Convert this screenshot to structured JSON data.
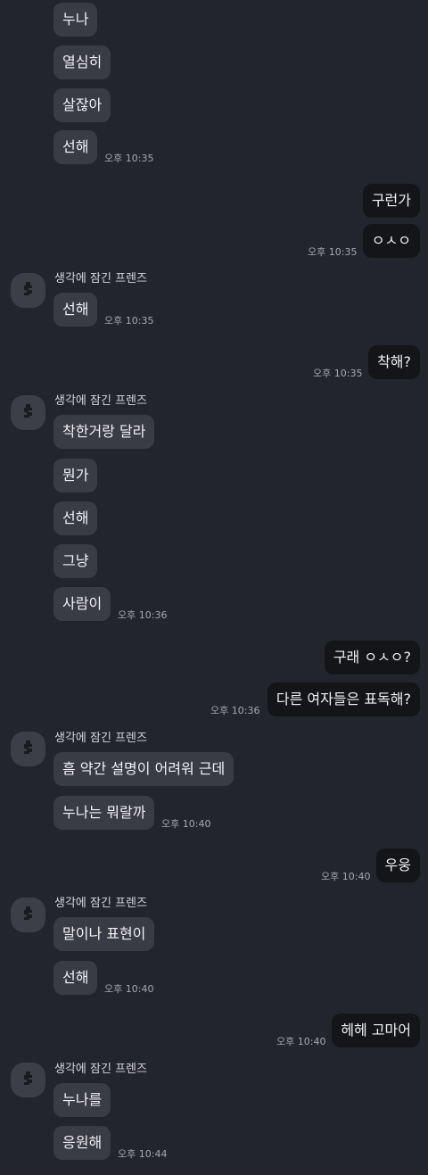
{
  "sender_name": "생각에 잠긴 프렌즈",
  "messages": {
    "m1": "누나",
    "m2": "열심히",
    "m3": "살잖아",
    "m4": "선해",
    "m5": "구런가",
    "m6": "ㅇㅅㅇ",
    "m7": "선해",
    "m8": "착해?",
    "m9": "착한거랑 달라",
    "m10": "뭔가",
    "m11": "선해",
    "m12": "그냥",
    "m13": "사람이",
    "m14": "구래 ㅇㅅㅇ?",
    "m15": "다른 여자들은 표독해?",
    "m16": "흠 약간 설명이 어려워 근데",
    "m17": "누나는 뭐랄까",
    "m18": "우웅",
    "m19": "말이나 표현이",
    "m20": "선해",
    "m21": "헤헤 고마어",
    "m22": "누나를",
    "m23": "응원해"
  },
  "times": {
    "t1": "오후 10:35",
    "t2": "오후 10:35",
    "t3": "오후 10:35",
    "t4": "오후 10:35",
    "t5": "오후 10:36",
    "t6": "오후 10:36",
    "t7": "오후 10:40",
    "t8": "오후 10:40",
    "t9": "오후 10:40",
    "t10": "오후 10:40",
    "t11": "오후 10:44"
  },
  "icons": {
    "avatar": "friend-silhouette-icon"
  },
  "colors": {
    "background": "#23252c",
    "incoming_bubble": "#3a3c44",
    "outgoing_bubble": "#141519",
    "text": "#f1f1f3",
    "timestamp": "#a7a8ad"
  }
}
